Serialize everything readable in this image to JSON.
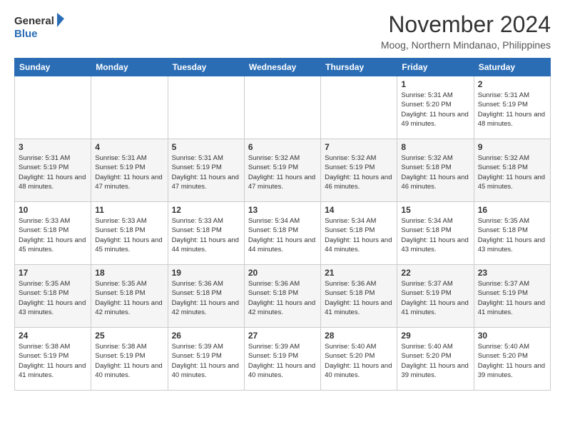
{
  "header": {
    "logo_line1": "General",
    "logo_line2": "Blue",
    "month_title": "November 2024",
    "location": "Moog, Northern Mindanao, Philippines"
  },
  "days_of_week": [
    "Sunday",
    "Monday",
    "Tuesday",
    "Wednesday",
    "Thursday",
    "Friday",
    "Saturday"
  ],
  "weeks": [
    [
      {
        "day": "",
        "info": ""
      },
      {
        "day": "",
        "info": ""
      },
      {
        "day": "",
        "info": ""
      },
      {
        "day": "",
        "info": ""
      },
      {
        "day": "",
        "info": ""
      },
      {
        "day": "1",
        "info": "Sunrise: 5:31 AM\nSunset: 5:20 PM\nDaylight: 11 hours and 49 minutes."
      },
      {
        "day": "2",
        "info": "Sunrise: 5:31 AM\nSunset: 5:19 PM\nDaylight: 11 hours and 48 minutes."
      }
    ],
    [
      {
        "day": "3",
        "info": "Sunrise: 5:31 AM\nSunset: 5:19 PM\nDaylight: 11 hours and 48 minutes."
      },
      {
        "day": "4",
        "info": "Sunrise: 5:31 AM\nSunset: 5:19 PM\nDaylight: 11 hours and 47 minutes."
      },
      {
        "day": "5",
        "info": "Sunrise: 5:31 AM\nSunset: 5:19 PM\nDaylight: 11 hours and 47 minutes."
      },
      {
        "day": "6",
        "info": "Sunrise: 5:32 AM\nSunset: 5:19 PM\nDaylight: 11 hours and 47 minutes."
      },
      {
        "day": "7",
        "info": "Sunrise: 5:32 AM\nSunset: 5:19 PM\nDaylight: 11 hours and 46 minutes."
      },
      {
        "day": "8",
        "info": "Sunrise: 5:32 AM\nSunset: 5:18 PM\nDaylight: 11 hours and 46 minutes."
      },
      {
        "day": "9",
        "info": "Sunrise: 5:32 AM\nSunset: 5:18 PM\nDaylight: 11 hours and 45 minutes."
      }
    ],
    [
      {
        "day": "10",
        "info": "Sunrise: 5:33 AM\nSunset: 5:18 PM\nDaylight: 11 hours and 45 minutes."
      },
      {
        "day": "11",
        "info": "Sunrise: 5:33 AM\nSunset: 5:18 PM\nDaylight: 11 hours and 45 minutes."
      },
      {
        "day": "12",
        "info": "Sunrise: 5:33 AM\nSunset: 5:18 PM\nDaylight: 11 hours and 44 minutes."
      },
      {
        "day": "13",
        "info": "Sunrise: 5:34 AM\nSunset: 5:18 PM\nDaylight: 11 hours and 44 minutes."
      },
      {
        "day": "14",
        "info": "Sunrise: 5:34 AM\nSunset: 5:18 PM\nDaylight: 11 hours and 44 minutes."
      },
      {
        "day": "15",
        "info": "Sunrise: 5:34 AM\nSunset: 5:18 PM\nDaylight: 11 hours and 43 minutes."
      },
      {
        "day": "16",
        "info": "Sunrise: 5:35 AM\nSunset: 5:18 PM\nDaylight: 11 hours and 43 minutes."
      }
    ],
    [
      {
        "day": "17",
        "info": "Sunrise: 5:35 AM\nSunset: 5:18 PM\nDaylight: 11 hours and 43 minutes."
      },
      {
        "day": "18",
        "info": "Sunrise: 5:35 AM\nSunset: 5:18 PM\nDaylight: 11 hours and 42 minutes."
      },
      {
        "day": "19",
        "info": "Sunrise: 5:36 AM\nSunset: 5:18 PM\nDaylight: 11 hours and 42 minutes."
      },
      {
        "day": "20",
        "info": "Sunrise: 5:36 AM\nSunset: 5:18 PM\nDaylight: 11 hours and 42 minutes."
      },
      {
        "day": "21",
        "info": "Sunrise: 5:36 AM\nSunset: 5:18 PM\nDaylight: 11 hours and 41 minutes."
      },
      {
        "day": "22",
        "info": "Sunrise: 5:37 AM\nSunset: 5:19 PM\nDaylight: 11 hours and 41 minutes."
      },
      {
        "day": "23",
        "info": "Sunrise: 5:37 AM\nSunset: 5:19 PM\nDaylight: 11 hours and 41 minutes."
      }
    ],
    [
      {
        "day": "24",
        "info": "Sunrise: 5:38 AM\nSunset: 5:19 PM\nDaylight: 11 hours and 41 minutes."
      },
      {
        "day": "25",
        "info": "Sunrise: 5:38 AM\nSunset: 5:19 PM\nDaylight: 11 hours and 40 minutes."
      },
      {
        "day": "26",
        "info": "Sunrise: 5:39 AM\nSunset: 5:19 PM\nDaylight: 11 hours and 40 minutes."
      },
      {
        "day": "27",
        "info": "Sunrise: 5:39 AM\nSunset: 5:19 PM\nDaylight: 11 hours and 40 minutes."
      },
      {
        "day": "28",
        "info": "Sunrise: 5:40 AM\nSunset: 5:20 PM\nDaylight: 11 hours and 40 minutes."
      },
      {
        "day": "29",
        "info": "Sunrise: 5:40 AM\nSunset: 5:20 PM\nDaylight: 11 hours and 39 minutes."
      },
      {
        "day": "30",
        "info": "Sunrise: 5:40 AM\nSunset: 5:20 PM\nDaylight: 11 hours and 39 minutes."
      }
    ]
  ]
}
